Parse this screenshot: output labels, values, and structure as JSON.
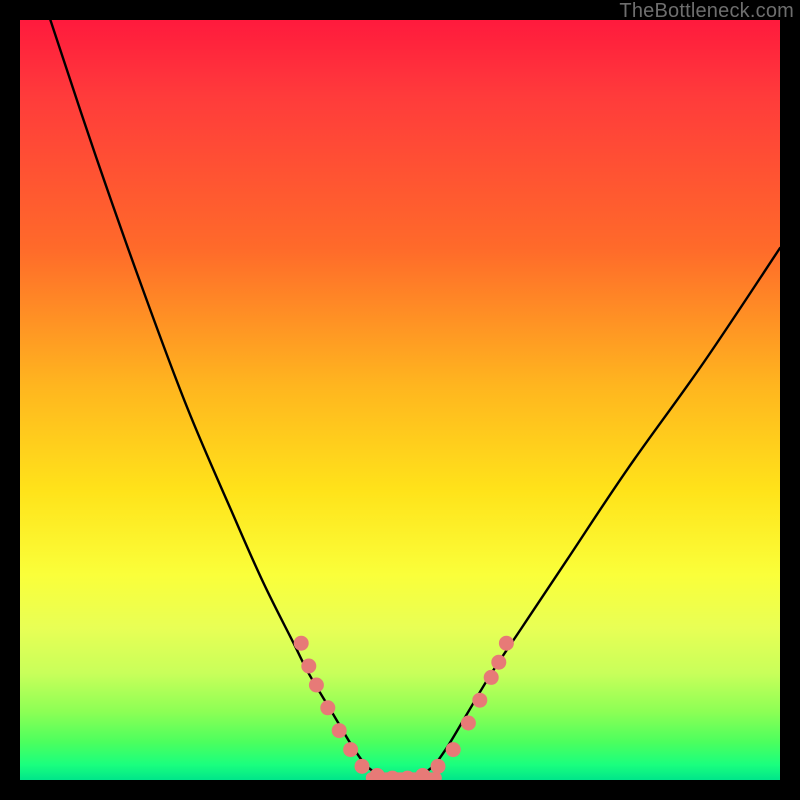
{
  "watermark": "TheBottleneck.com",
  "chart_data": {
    "type": "line",
    "title": "",
    "xlabel": "",
    "ylabel": "",
    "xlim": [
      0,
      100
    ],
    "ylim": [
      0,
      100
    ],
    "series": [
      {
        "name": "curve",
        "x": [
          4,
          10,
          16,
          22,
          28,
          32,
          36,
          38,
          41,
          44,
          46,
          48,
          50,
          52,
          54,
          56,
          59,
          62,
          66,
          72,
          80,
          90,
          100
        ],
        "values": [
          100,
          82,
          65,
          49,
          35,
          26,
          18,
          14,
          9,
          4,
          1.5,
          0.5,
          0.2,
          0.5,
          1.5,
          4,
          9,
          14,
          20,
          29,
          41,
          55,
          70
        ]
      }
    ],
    "markers": {
      "name": "highlight-dots",
      "color": "#e77a77",
      "points": [
        {
          "x": 37.0,
          "y": 18.0
        },
        {
          "x": 38.0,
          "y": 15.0
        },
        {
          "x": 39.0,
          "y": 12.5
        },
        {
          "x": 40.5,
          "y": 9.5
        },
        {
          "x": 42.0,
          "y": 6.5
        },
        {
          "x": 43.5,
          "y": 4.0
        },
        {
          "x": 45.0,
          "y": 1.8
        },
        {
          "x": 47.0,
          "y": 0.6
        },
        {
          "x": 49.0,
          "y": 0.25
        },
        {
          "x": 51.0,
          "y": 0.25
        },
        {
          "x": 53.0,
          "y": 0.6
        },
        {
          "x": 55.0,
          "y": 1.8
        },
        {
          "x": 57.0,
          "y": 4.0
        },
        {
          "x": 59.0,
          "y": 7.5
        },
        {
          "x": 60.5,
          "y": 10.5
        },
        {
          "x": 62.0,
          "y": 13.5
        },
        {
          "x": 63.0,
          "y": 15.5
        },
        {
          "x": 64.0,
          "y": 18.0
        }
      ]
    },
    "bottom_bar": {
      "name": "flat-segment",
      "color": "#e77a77",
      "x_start": 45.5,
      "x_end": 55.5,
      "y": 0.3,
      "thickness": 1.4
    }
  }
}
